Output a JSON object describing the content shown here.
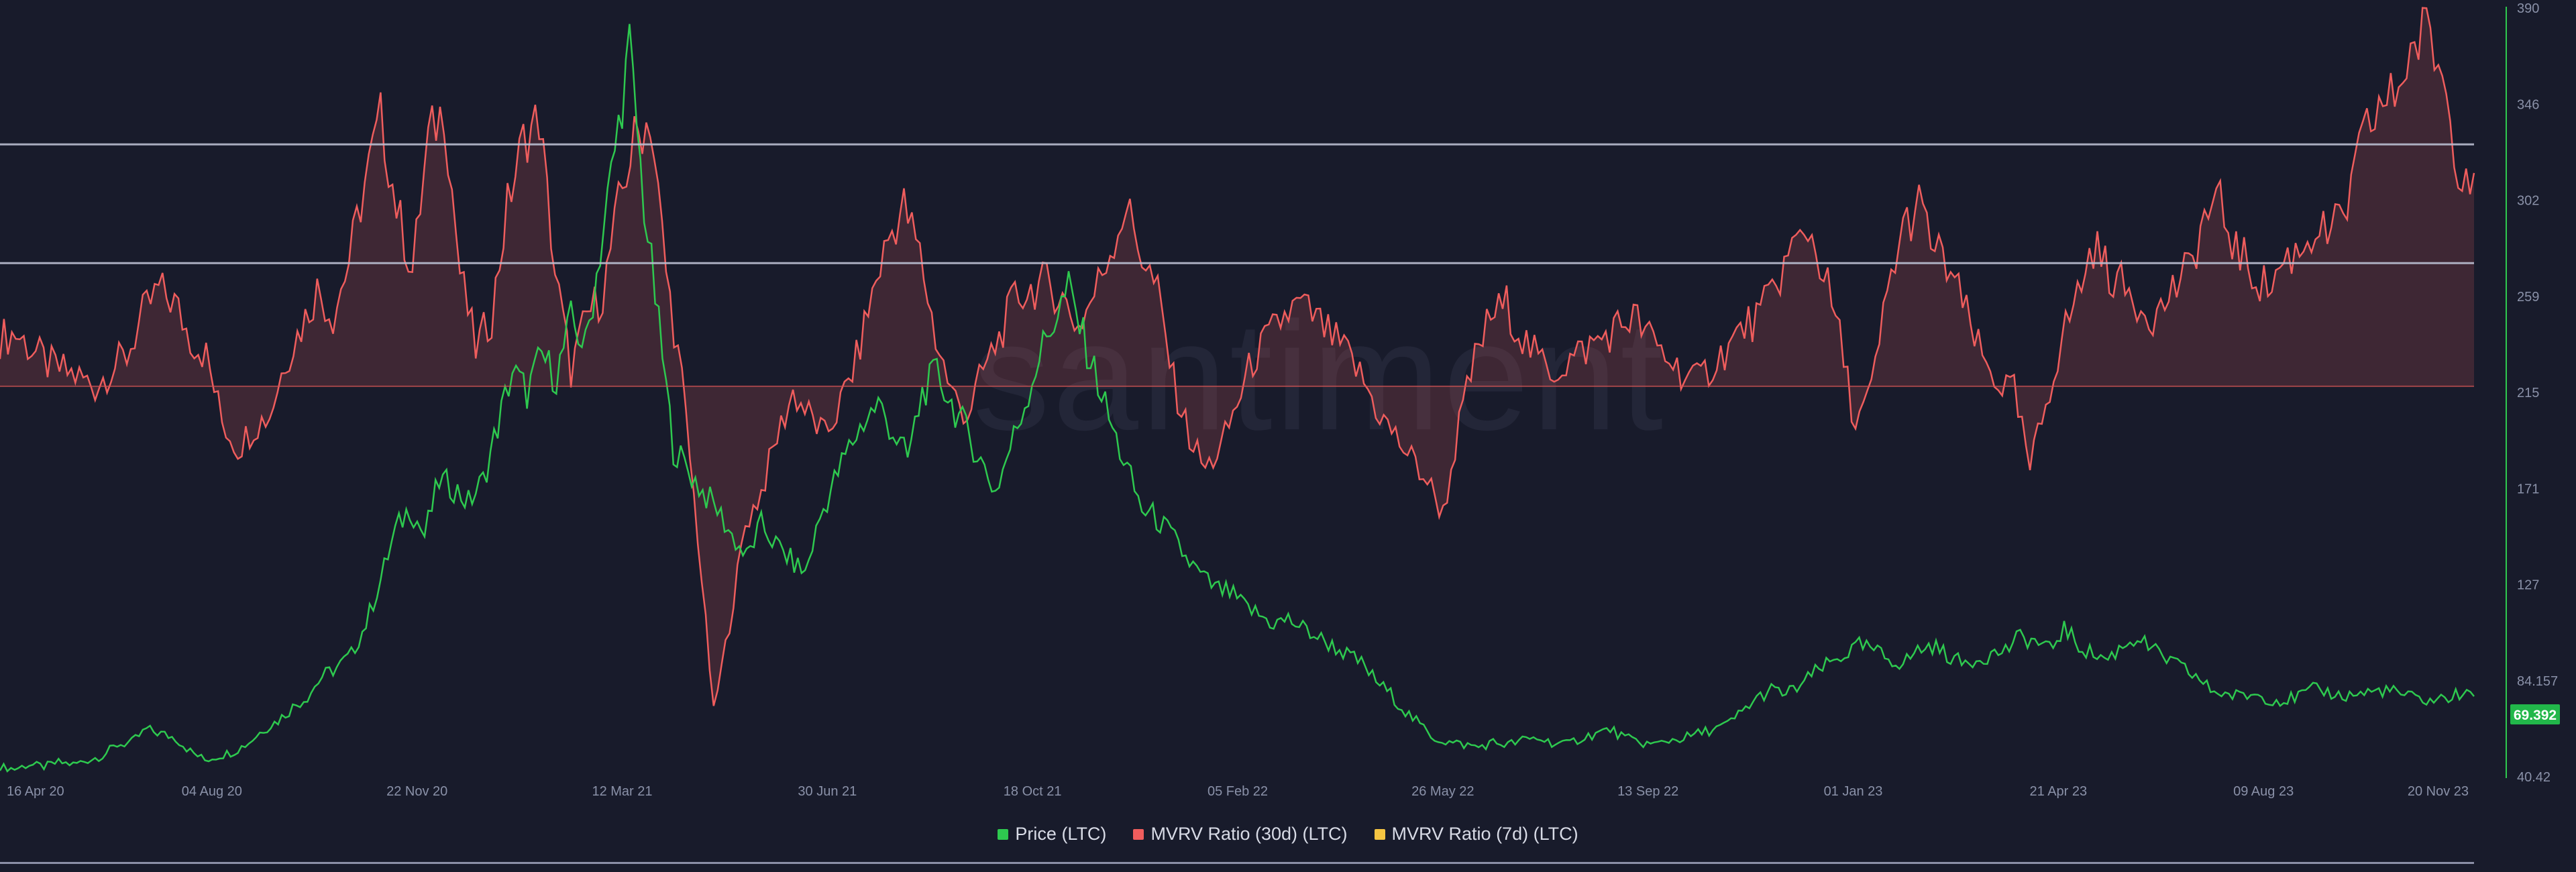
{
  "watermark": "santiment",
  "legend": [
    {
      "label": "Price (LTC)",
      "color": "#2ec94f"
    },
    {
      "label": "MVRV Ratio (30d) (LTC)",
      "color": "#ef5d5d"
    },
    {
      "label": "MVRV Ratio (7d) (LTC)",
      "color": "#f5c542"
    }
  ],
  "current_price_label": "69.392",
  "chart_data": {
    "type": "line",
    "x_tick_labels": [
      "16 Apr 20",
      "04 Aug 20",
      "22 Nov 20",
      "12 Mar 21",
      "30 Jun 21",
      "18 Oct 21",
      "05 Feb 22",
      "26 May 22",
      "13 Sep 22",
      "01 Jan 23",
      "21 Apr 23",
      "09 Aug 23",
      "20 Nov 23"
    ],
    "y_tick_labels": [
      "390",
      "346",
      "302",
      "259",
      "215",
      "171",
      "127",
      "84.157",
      "40.42"
    ],
    "ylim": [
      40.42,
      390
    ],
    "reference_lines": [
      {
        "name": "upper",
        "color": "#b9bdd0"
      },
      {
        "name": "middle",
        "color": "#b9bdd0"
      },
      {
        "name": "baseline",
        "color": "#d35454"
      }
    ],
    "series": [
      {
        "name": "Price (LTC)",
        "color": "#2ec94f",
        "values": [
          45,
          44,
          46,
          45,
          47,
          46,
          48,
          50,
          55,
          56,
          62,
          60,
          58,
          52,
          48,
          50,
          52,
          56,
          62,
          66,
          72,
          77,
          86,
          90,
          96,
          110,
          130,
          152,
          163,
          150,
          175,
          172,
          165,
          175,
          200,
          225,
          215,
          232,
          222,
          248,
          236,
          280,
          325,
          372,
          300,
          245,
          190,
          180,
          170,
          162,
          150,
          140,
          155,
          146,
          139,
          133,
          158,
          175,
          190,
          202,
          210,
          197,
          185,
          215,
          224,
          210,
          198,
          184,
          170,
          190,
          210,
          232,
          248,
          262,
          240,
          220,
          198,
          180,
          162,
          158,
          150,
          140,
          132,
          126,
          124,
          118,
          114,
          110,
          112,
          108,
          104,
          100,
          96,
          92,
          84,
          78,
          70,
          64,
          58,
          56,
          55,
          54,
          56,
          55,
          57,
          58,
          56,
          55,
          58,
          60,
          62,
          58,
          56,
          55,
          57,
          58,
          60,
          62,
          64,
          70,
          76,
          80,
          78,
          82,
          88,
          92,
          96,
          100,
          98,
          94,
          92,
          98,
          100,
          96,
          92,
          94,
          96,
          98,
          104,
          102,
          98,
          108,
          100,
          96,
          94,
          100,
          104,
          98,
          94,
          90,
          86,
          80,
          78,
          77,
          78,
          76,
          75,
          77,
          80,
          79,
          77,
          78,
          79,
          80,
          78,
          76,
          75,
          76,
          78,
          77
        ]
      },
      {
        "name": "MVRV Ratio (30d) (LTC)",
        "color": "#ef5d5d",
        "values": [
          240,
          242,
          235,
          228,
          225,
          222,
          218,
          226,
          232,
          250,
          262,
          256,
          240,
          232,
          202,
          190,
          200,
          205,
          230,
          245,
          262,
          250,
          275,
          310,
          340,
          300,
          270,
          330,
          345,
          270,
          235,
          250,
          300,
          330,
          340,
          270,
          225,
          250,
          260,
          300,
          330,
          340,
          270,
          220,
          150,
          70,
          110,
          155,
          170,
          195,
          215,
          205,
          195,
          210,
          230,
          260,
          285,
          300,
          278,
          240,
          215,
          205,
          225,
          240,
          258,
          262,
          265,
          258,
          245,
          260,
          280,
          300,
          278,
          260,
          220,
          195,
          180,
          190,
          210,
          230,
          240,
          250,
          255,
          248,
          240,
          232,
          220,
          205,
          195,
          185,
          175,
          160,
          200,
          230,
          250,
          255,
          240,
          230,
          225,
          230,
          235,
          240,
          245,
          250,
          240,
          232,
          225,
          220,
          228,
          236,
          245,
          250,
          265,
          280,
          290,
          270,
          240,
          200,
          215,
          260,
          290,
          300,
          280,
          270,
          250,
          230,
          220,
          215,
          180,
          210,
          240,
          260,
          282,
          270,
          262,
          255,
          250,
          262,
          270,
          295,
          300,
          280,
          270,
          262,
          275,
          280,
          290,
          286,
          300,
          330,
          345,
          350,
          370,
          380,
          360,
          320,
          315
        ]
      },
      {
        "name": "MVRV Ratio (7d) (LTC)",
        "color": "#f5c542",
        "values": []
      }
    ]
  }
}
